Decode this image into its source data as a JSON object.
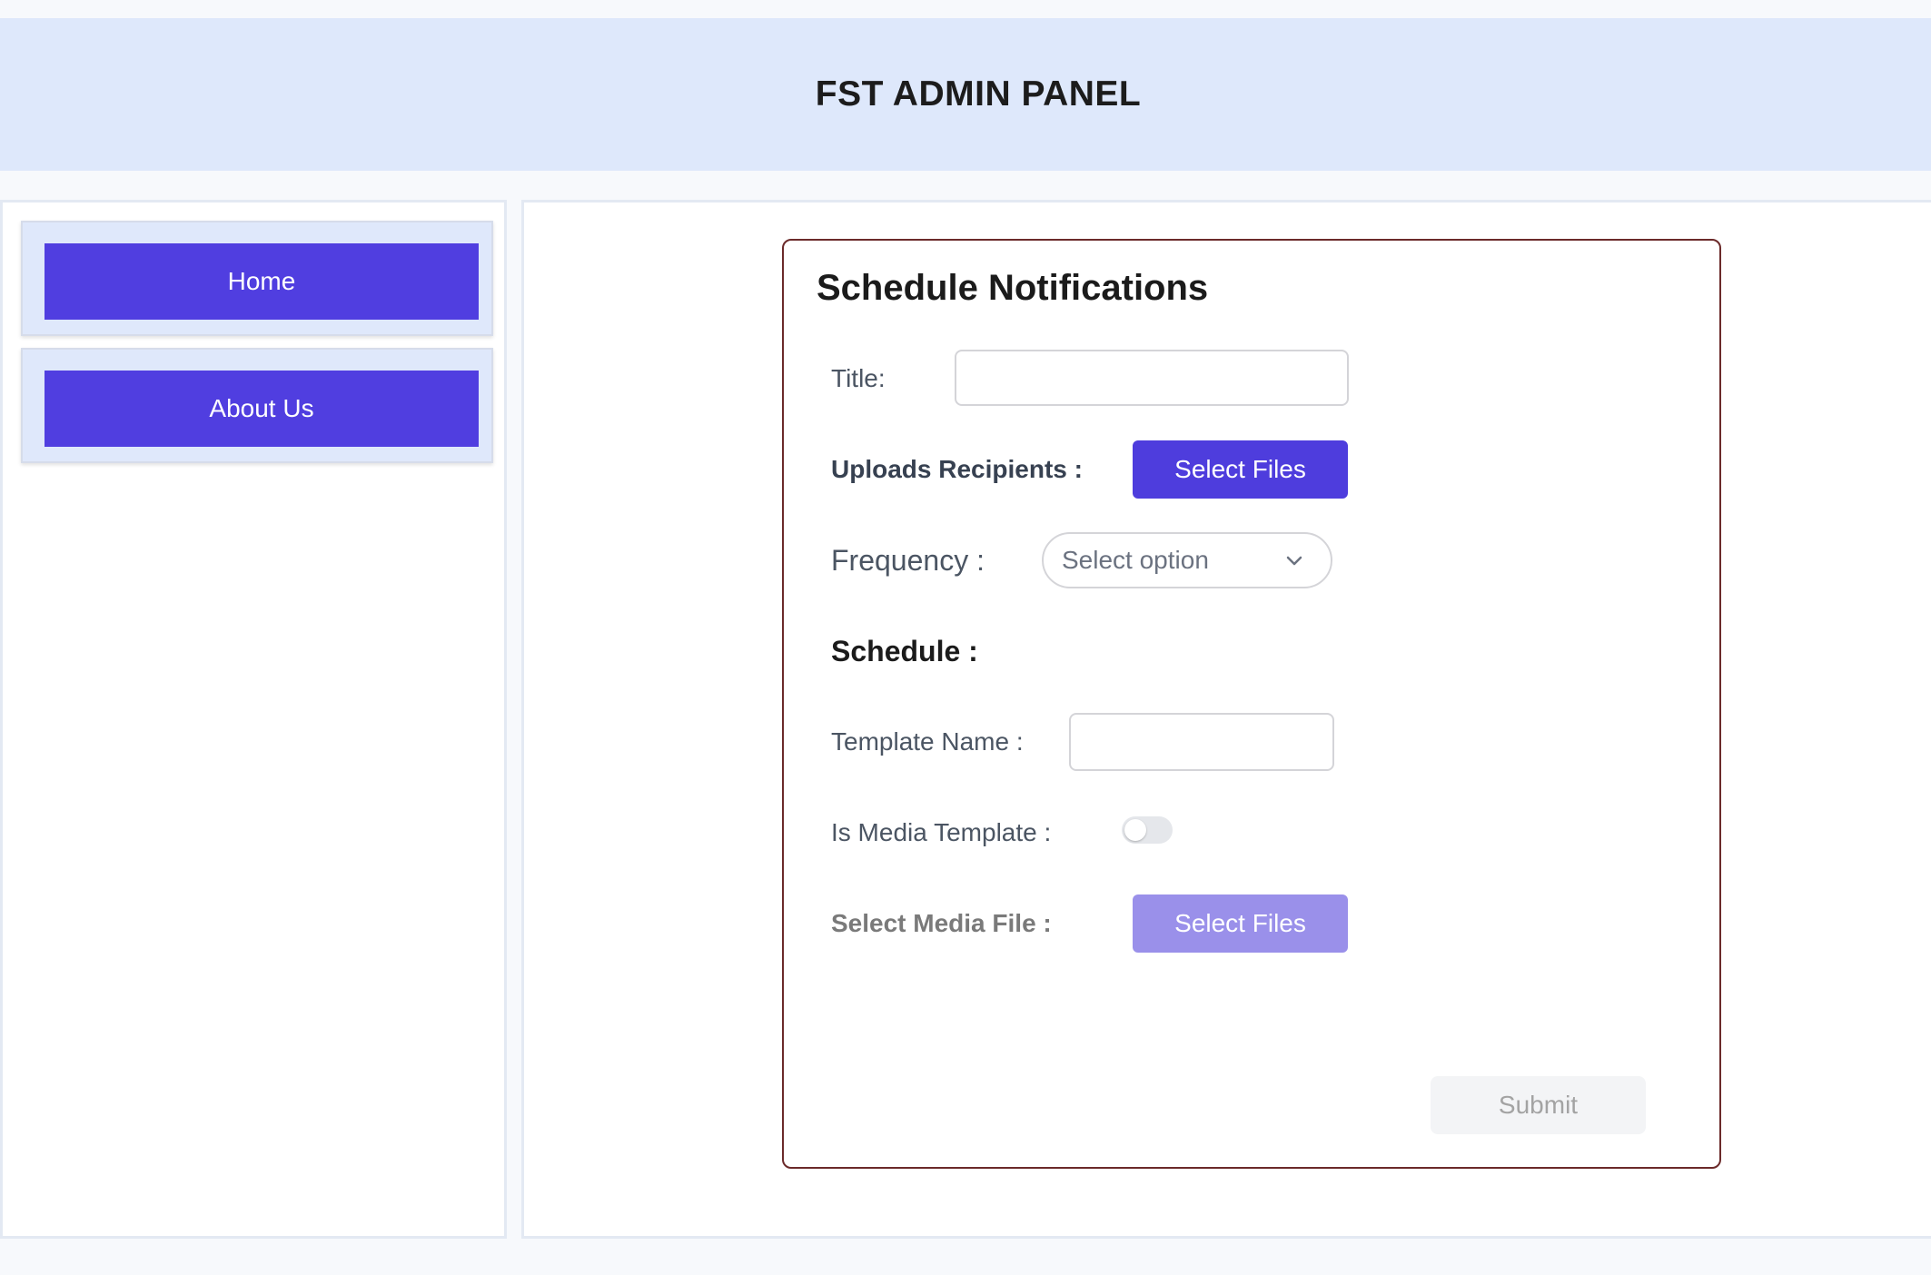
{
  "header": {
    "title": "FST ADMIN PANEL"
  },
  "sidebar": {
    "items": [
      {
        "label": "Home"
      },
      {
        "label": "About Us"
      }
    ]
  },
  "form": {
    "title": "Schedule Notifications",
    "title_label": "Title:",
    "title_value": "",
    "recipients_label": "Uploads Recipients :",
    "recipients_button": "Select Files",
    "frequency_label": "Frequency :",
    "frequency_selected": "Select option",
    "schedule_heading": "Schedule :",
    "template_name_label": "Template Name :",
    "template_name_value": "",
    "is_media_label": "Is Media Template :",
    "is_media_enabled": false,
    "media_file_label": "Select Media File :",
    "media_file_button": "Select Files",
    "submit_label": "Submit"
  },
  "colors": {
    "accent": "#503ee0",
    "accent_disabled": "#9a90ea",
    "header_bg": "#dee8fb",
    "card_border": "#6b2a2a"
  },
  "icons": {
    "frequency_dropdown": "chevron-down-icon"
  }
}
